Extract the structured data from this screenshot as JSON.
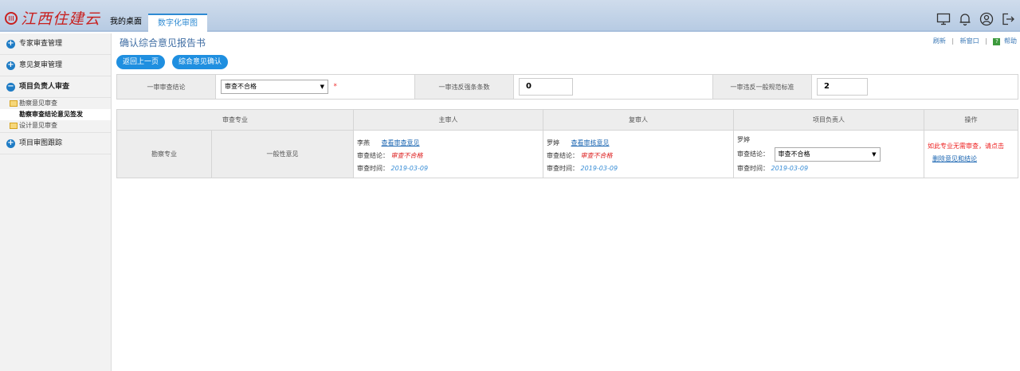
{
  "header": {
    "logo_text": "江西住建云",
    "tabs": [
      {
        "label": "我的桌面"
      },
      {
        "label": "数字化审图"
      }
    ]
  },
  "sidebar": {
    "items": [
      {
        "label": "专家审查管理"
      },
      {
        "label": "意见复审管理"
      },
      {
        "label": "项目负责人审查"
      },
      {
        "label": "项目审图跟踪"
      }
    ],
    "sub_items": [
      {
        "label": "勘察意见审查"
      },
      {
        "label": "勘察审查结论意见签发"
      },
      {
        "label": "设计意见审查"
      }
    ]
  },
  "main": {
    "title": "确认综合意见报告书",
    "actions": {
      "refresh": "刷新",
      "new_window": "新窗口",
      "help": "帮助",
      "sep": "|"
    },
    "buttons": {
      "back": "返回上一页",
      "confirm": "综合意见确认"
    },
    "summary": {
      "conclusion_label": "一审审查结论",
      "conclusion_value": "审查不合格",
      "required_mark": "*",
      "strong_label": "一审违反强条条数",
      "strong_value": "0",
      "general_label": "一审违反一般规范标准",
      "general_value": "2"
    },
    "table": {
      "headers": [
        "审查专业",
        "主审人",
        "复审人",
        "项目负责人",
        "操作"
      ],
      "row": {
        "specialty": "勘察专业",
        "opinion_type": "一般性意见",
        "main_reviewer": {
          "name": "李燕",
          "link": "查看审查意见",
          "conclusion_label": "审查结论：",
          "conclusion": "审查不合格",
          "time_label": "审查时间：",
          "time": "2019-03-09"
        },
        "re_reviewer": {
          "name": "罗婷",
          "link": "查看审核意见",
          "conclusion_label": "审查结论：",
          "conclusion": "审查不合格",
          "time_label": "审查时间：",
          "time": "2019-03-09"
        },
        "project_lead": {
          "name": "罗婷",
          "conclusion_label": "审查结论：",
          "conclusion": "审查不合格",
          "time_label": "审查时间：",
          "time": "2019-03-09"
        },
        "operation": {
          "text": "如此专业无需审查，请点击",
          "link": "删除意见和结论"
        }
      }
    }
  },
  "colors": {
    "accent": "#1f8fe0",
    "brand": "#c8201f",
    "error": "#dd2222"
  },
  "icons": [
    "logo-icon",
    "monitor-icon",
    "bell-icon",
    "user-icon",
    "logout-icon",
    "plus-circle-icon",
    "minus-circle-icon",
    "folder-icon",
    "help-icon",
    "dropdown-arrow-icon"
  ]
}
